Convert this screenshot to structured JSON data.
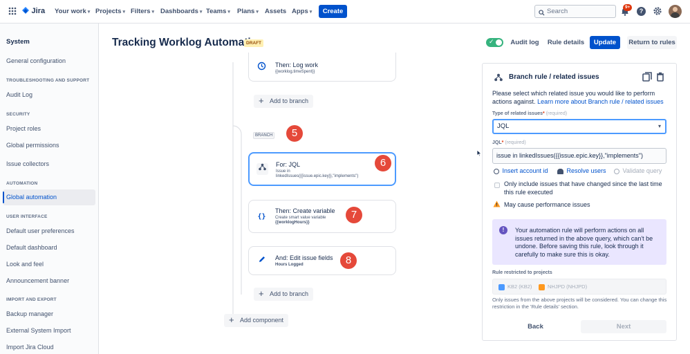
{
  "topbar": {
    "logo": "Jira",
    "nav": [
      "Your work",
      "Projects",
      "Filters",
      "Dashboards",
      "Teams",
      "Plans",
      "Assets",
      "Apps"
    ],
    "create": "Create",
    "search_placeholder": "Search",
    "notif_badge": "9+"
  },
  "sidebar": {
    "system": "System",
    "general_config": "General configuration",
    "sections": [
      {
        "heading": "TROUBLESHOOTING AND SUPPORT",
        "items": [
          "Audit Log"
        ]
      },
      {
        "heading": "SECURITY",
        "items": [
          "Project roles",
          "Global permissions",
          "Issue collectors"
        ]
      },
      {
        "heading": "AUTOMATION",
        "items": [
          "Global automation"
        ]
      },
      {
        "heading": "USER INTERFACE",
        "items": [
          "Default user preferences",
          "Default dashboard",
          "Look and feel",
          "Announcement banner"
        ]
      },
      {
        "heading": "IMPORT AND EXPORT",
        "items": [
          "Backup manager",
          "External System Import",
          "Import Jira Cloud"
        ]
      }
    ]
  },
  "header": {
    "title": "Tracking Worklog Automation",
    "draft": "DRAFT",
    "audit_log": "Audit log",
    "rule_details": "Rule details",
    "update": "Update",
    "return": "Return to rules"
  },
  "canvas": {
    "log_work_title": "Then: Log work",
    "log_work_sub": "{{worklog.timeSpent}}",
    "add_to_branch": "Add to branch",
    "branch_label": "BRANCH",
    "badge5": "5",
    "jql_title": "For: JQL",
    "jql_sub1": "Issue in",
    "jql_sub2": "linkedIssues({{issue.epic.key}},\"implements\")",
    "badge6": "6",
    "create_var_title": "Then: Create variable",
    "create_var_sub1": "Create smart value variable",
    "create_var_sub2": "{{worklogHours}}",
    "badge7": "7",
    "edit_title": "And: Edit issue fields",
    "edit_sub": "Hours Logged",
    "badge8": "8",
    "add_component": "Add component"
  },
  "panel": {
    "title": "Branch rule / related issues",
    "desc": "Please select which related issue you would like to perform actions against.",
    "learn_more": "Learn more about Branch rule / related issues",
    "type_label": "Type of related issues",
    "required": "(required)",
    "type_value": "JQL",
    "jql_label": "JQL",
    "jql_value": "issue in linkedIssues({{issue.epic.key}},\"implements\")",
    "insert_account": "Insert account id",
    "resolve_users": "Resolve users",
    "validate_query": "Validate query",
    "only_include": "Only include issues that have changed since the last time this rule executed",
    "warning": "May cause performance issues",
    "info": "Your automation rule will perform actions on all issues returned in the above query, which can't be undone. Before saving this rule, look through it carefully to make sure this is okay.",
    "restricted_label": "Rule restricted to projects",
    "project1": "KB2 (KB2)",
    "project2": "NHJPD (NHJPD)",
    "restricted_note": "Only issues from the above projects will be considered. You can change this restriction in the 'Rule details' section.",
    "back": "Back",
    "next": "Next"
  },
  "colors": {
    "accent": "#0052cc",
    "badge": "#e5493a",
    "toggle": "#36b37e"
  }
}
